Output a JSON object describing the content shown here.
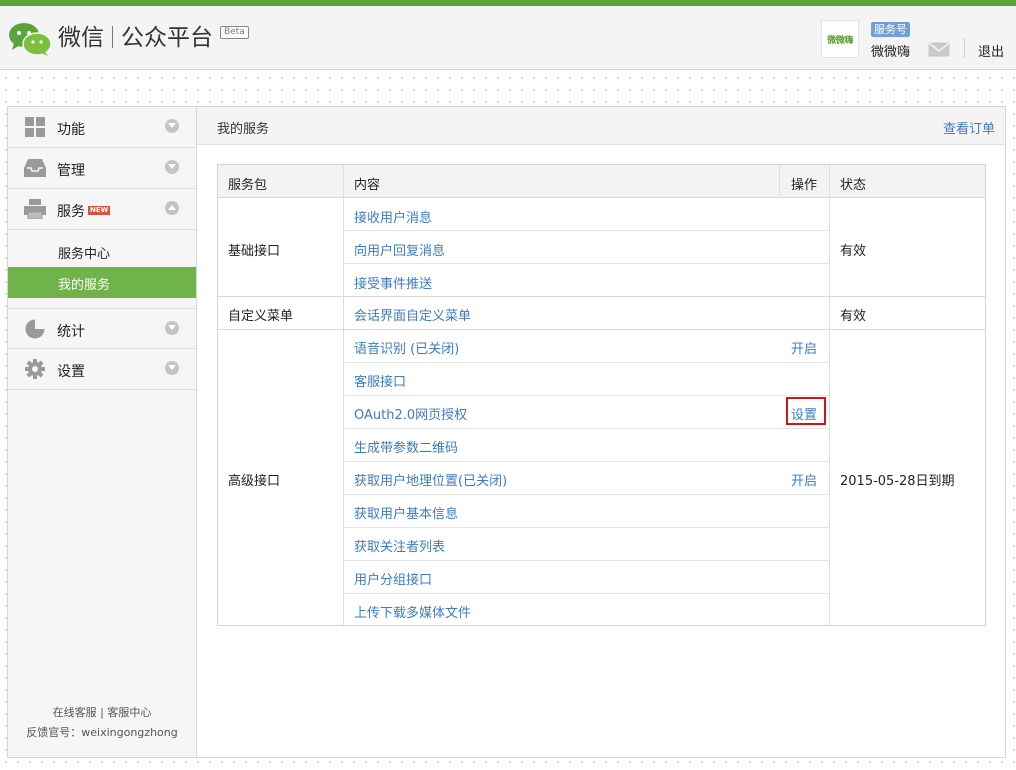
{
  "header": {
    "logo_text": "微信",
    "platform_text": "公众平台",
    "beta_label": "Beta",
    "account": {
      "avatar_text": "微微嗨",
      "type_badge": "服务号",
      "name": "微微嗨"
    },
    "logout_label": "退出",
    "mail_icon": "mail-icon"
  },
  "sidebar": {
    "items": [
      {
        "label": "功能",
        "icon": "grid-icon"
      },
      {
        "label": "管理",
        "icon": "inbox-icon"
      },
      {
        "label": "服务",
        "icon": "printer-icon",
        "badge": "NEW",
        "expanded": true
      },
      {
        "label": "统计",
        "icon": "pie-chart-icon"
      },
      {
        "label": "设置",
        "icon": "gear-icon"
      }
    ],
    "sub_items": [
      {
        "label": "服务中心"
      },
      {
        "label": "我的服务",
        "active": true
      }
    ],
    "footer": {
      "online_support": "在线客服",
      "service_center": "客服中心",
      "feedback_label": "反馈官号：",
      "feedback_account": "weixingongzhong"
    }
  },
  "content": {
    "title": "我的服务",
    "orders_link": "查看订单",
    "table": {
      "headers": [
        "服务包",
        "内容",
        "操作",
        "状态"
      ],
      "groups": [
        {
          "package": "基础接口",
          "status": "有效",
          "rows": [
            {
              "content": "接收用户消息",
              "action": ""
            },
            {
              "content": "向用户回复消息",
              "action": ""
            },
            {
              "content": "接受事件推送",
              "action": ""
            }
          ]
        },
        {
          "package": "自定义菜单",
          "status": "有效",
          "rows": [
            {
              "content": "会话界面自定义菜单",
              "action": ""
            }
          ]
        },
        {
          "package": "高级接口",
          "status": "2015-05-28日到期",
          "rows": [
            {
              "content": "语音识别 (已关闭)",
              "action": "开启"
            },
            {
              "content": "客服接口",
              "action": ""
            },
            {
              "content": "OAuth2.0网页授权",
              "action": "设置",
              "highlighted": true
            },
            {
              "content": "生成带参数二维码",
              "action": ""
            },
            {
              "content": "获取用户地理位置(已关闭)",
              "action": "开启"
            },
            {
              "content": "获取用户基本信息",
              "action": ""
            },
            {
              "content": "获取关注者列表",
              "action": ""
            },
            {
              "content": "用户分组接口",
              "action": ""
            },
            {
              "content": "上传下载多媒体文件",
              "action": ""
            }
          ]
        }
      ]
    }
  },
  "colors": {
    "brand_green": "#57a53b",
    "active_nav": "#6fb34a",
    "link_blue": "#3e7bbf",
    "highlight_red": "#d0141c"
  }
}
